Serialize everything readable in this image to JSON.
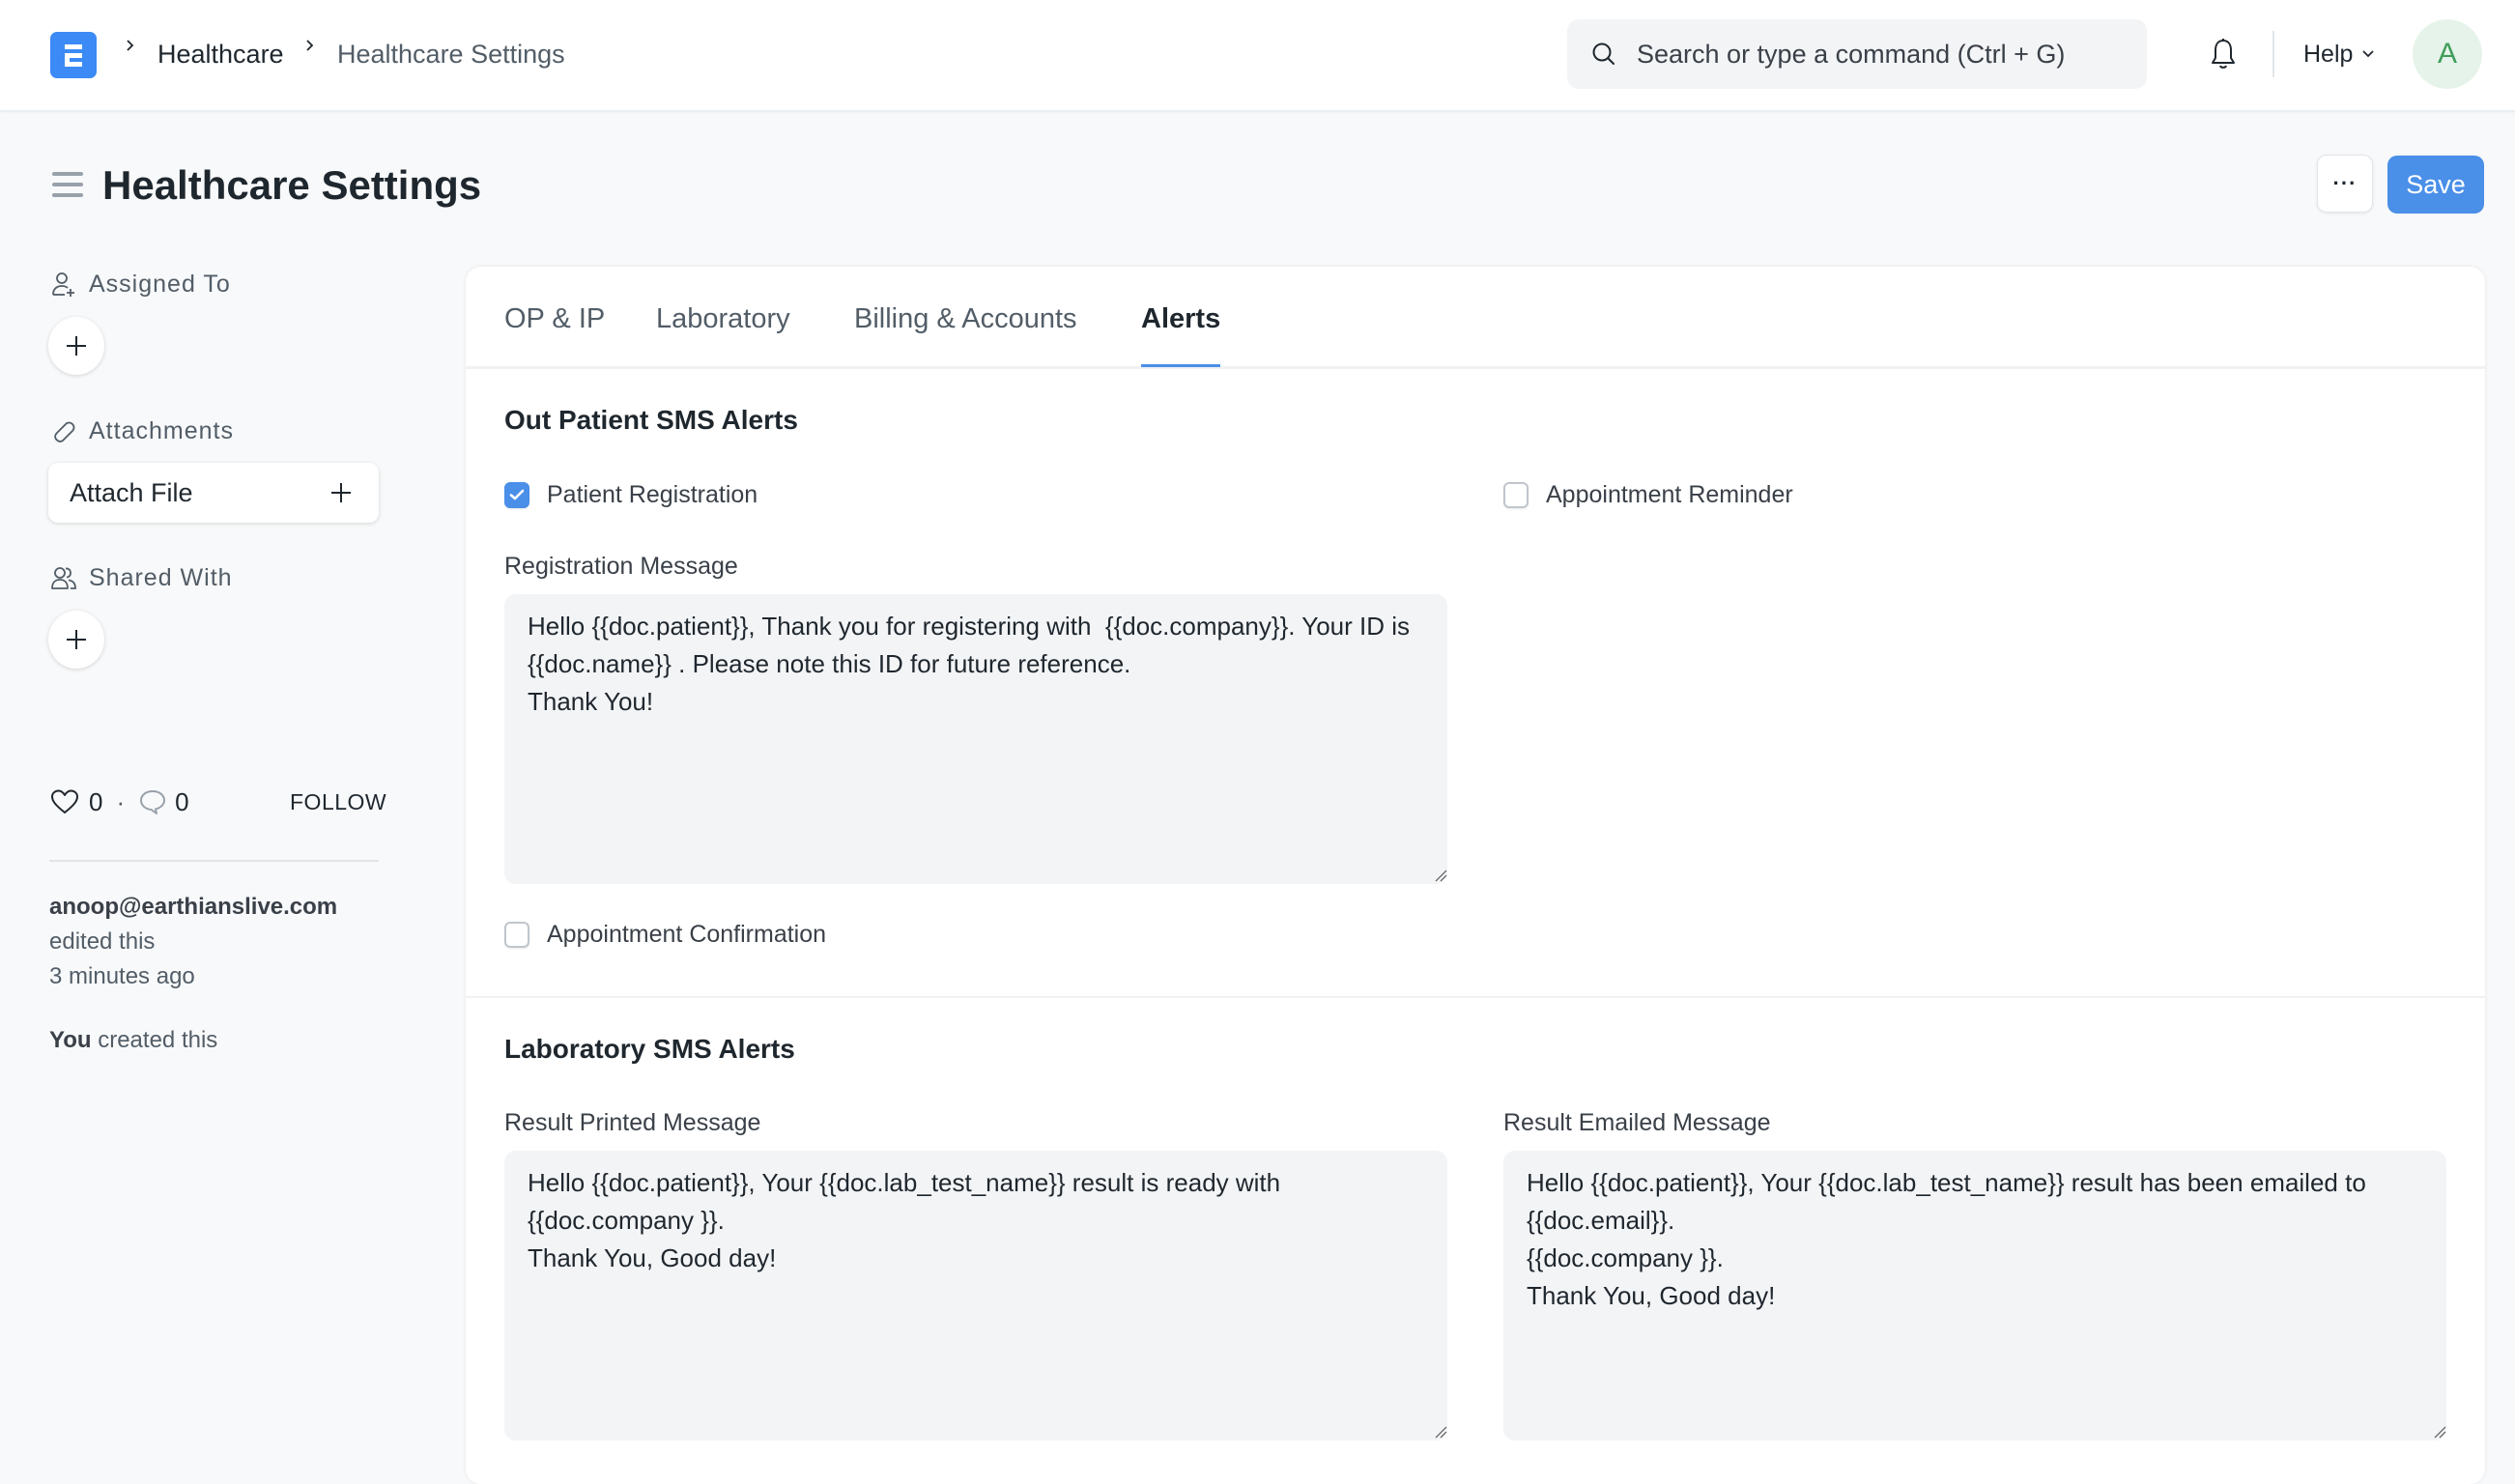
{
  "navbar": {
    "logo_letter": "E",
    "breadcrumbs": [
      "Healthcare",
      "Healthcare Settings"
    ],
    "search_placeholder": "Search or type a command (Ctrl + G)",
    "help_label": "Help",
    "avatar_initial": "A"
  },
  "page": {
    "title": "Healthcare Settings",
    "more_label": "···",
    "save_label": "Save"
  },
  "sidebar": {
    "assigned_to_label": "Assigned To",
    "attachments_label": "Attachments",
    "attach_file_label": "Attach File",
    "shared_with_label": "Shared With",
    "likes_count": "0",
    "comments_count": "0",
    "separator": "·",
    "follow_label": "FOLLOW",
    "activity": {
      "editor": "anoop@earthianslive.com",
      "edited_text": "edited this",
      "edited_time": "3 minutes ago",
      "creator": "You",
      "created_text": "created this"
    }
  },
  "tabs": [
    {
      "label": "OP & IP",
      "active": false
    },
    {
      "label": "Laboratory",
      "active": false
    },
    {
      "label": "Billing & Accounts",
      "active": false
    },
    {
      "label": "Alerts",
      "active": true
    }
  ],
  "out_patient": {
    "title": "Out Patient SMS Alerts",
    "patient_registration": {
      "label": "Patient Registration",
      "checked": true
    },
    "appointment_reminder": {
      "label": "Appointment Reminder",
      "checked": false
    },
    "registration_message_label": "Registration Message",
    "registration_message": "Hello {{doc.patient}}, Thank you for registering with  {{doc.company}}. Your ID is {{doc.name}} . Please note this ID for future reference.\nThank You!",
    "appointment_confirmation": {
      "label": "Appointment Confirmation",
      "checked": false
    }
  },
  "laboratory": {
    "title": "Laboratory SMS Alerts",
    "result_printed_label": "Result Printed Message",
    "result_printed_message": "Hello {{doc.patient}}, Your {{doc.lab_test_name}} result is ready with {{doc.company }}.\nThank You, Good day!",
    "result_emailed_label": "Result Emailed Message",
    "result_emailed_message": "Hello {{doc.patient}}, Your {{doc.lab_test_name}} result has been emailed to {{doc.email}}.\n{{doc.company }}.\nThank You, Good day!"
  },
  "colors": {
    "accent": "#4a8fe8",
    "logo": "#3b8af5",
    "avatar_bg": "#e6f3ea",
    "avatar_fg": "#3f9d5a"
  }
}
